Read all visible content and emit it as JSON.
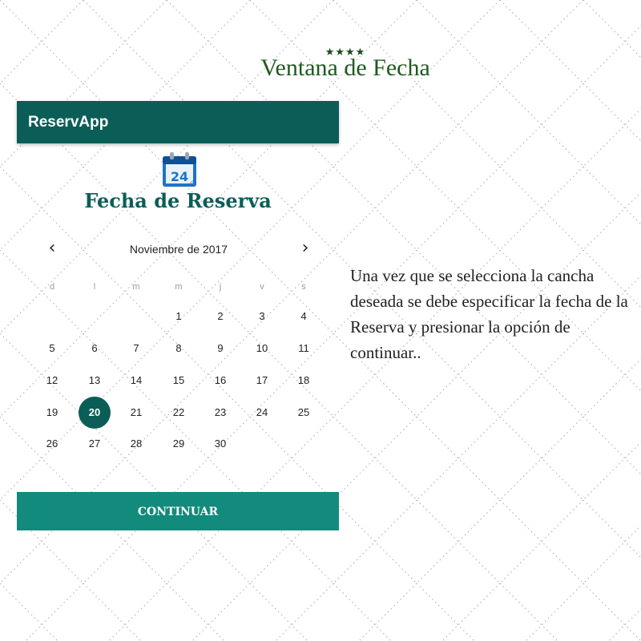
{
  "header": {
    "stars": "★★★★",
    "title": "Ventana de Fecha"
  },
  "app": {
    "app_bar_title": "ReservApp",
    "screen_title": "Fecha de Reserva",
    "calendar_icon": {
      "name": "calendar-icon",
      "day": "24"
    },
    "calendar": {
      "month_label": "Noviembre de 2017",
      "prev_icon": "‹",
      "next_icon": "›",
      "weekdays": [
        "d",
        "l",
        "m",
        "m",
        "j",
        "v",
        "s"
      ],
      "weeks": [
        [
          "",
          "",
          "",
          "1",
          "2",
          "3",
          "4"
        ],
        [
          "5",
          "6",
          "7",
          "8",
          "9",
          "10",
          "11"
        ],
        [
          "12",
          "13",
          "14",
          "15",
          "16",
          "17",
          "18"
        ],
        [
          "19",
          "20",
          "21",
          "22",
          "23",
          "24",
          "25"
        ],
        [
          "26",
          "27",
          "28",
          "29",
          "30",
          "",
          ""
        ]
      ],
      "selected_day": "20"
    },
    "continue_label": "CONTINUAR"
  },
  "description": "Una vez que se selecciona la cancha deseada se debe especificar la fecha de la Reserva y presionar la opción de continuar..",
  "colors": {
    "primary": "#0b5e57",
    "button": "#128a7c",
    "heading": "#1f5a1f"
  }
}
